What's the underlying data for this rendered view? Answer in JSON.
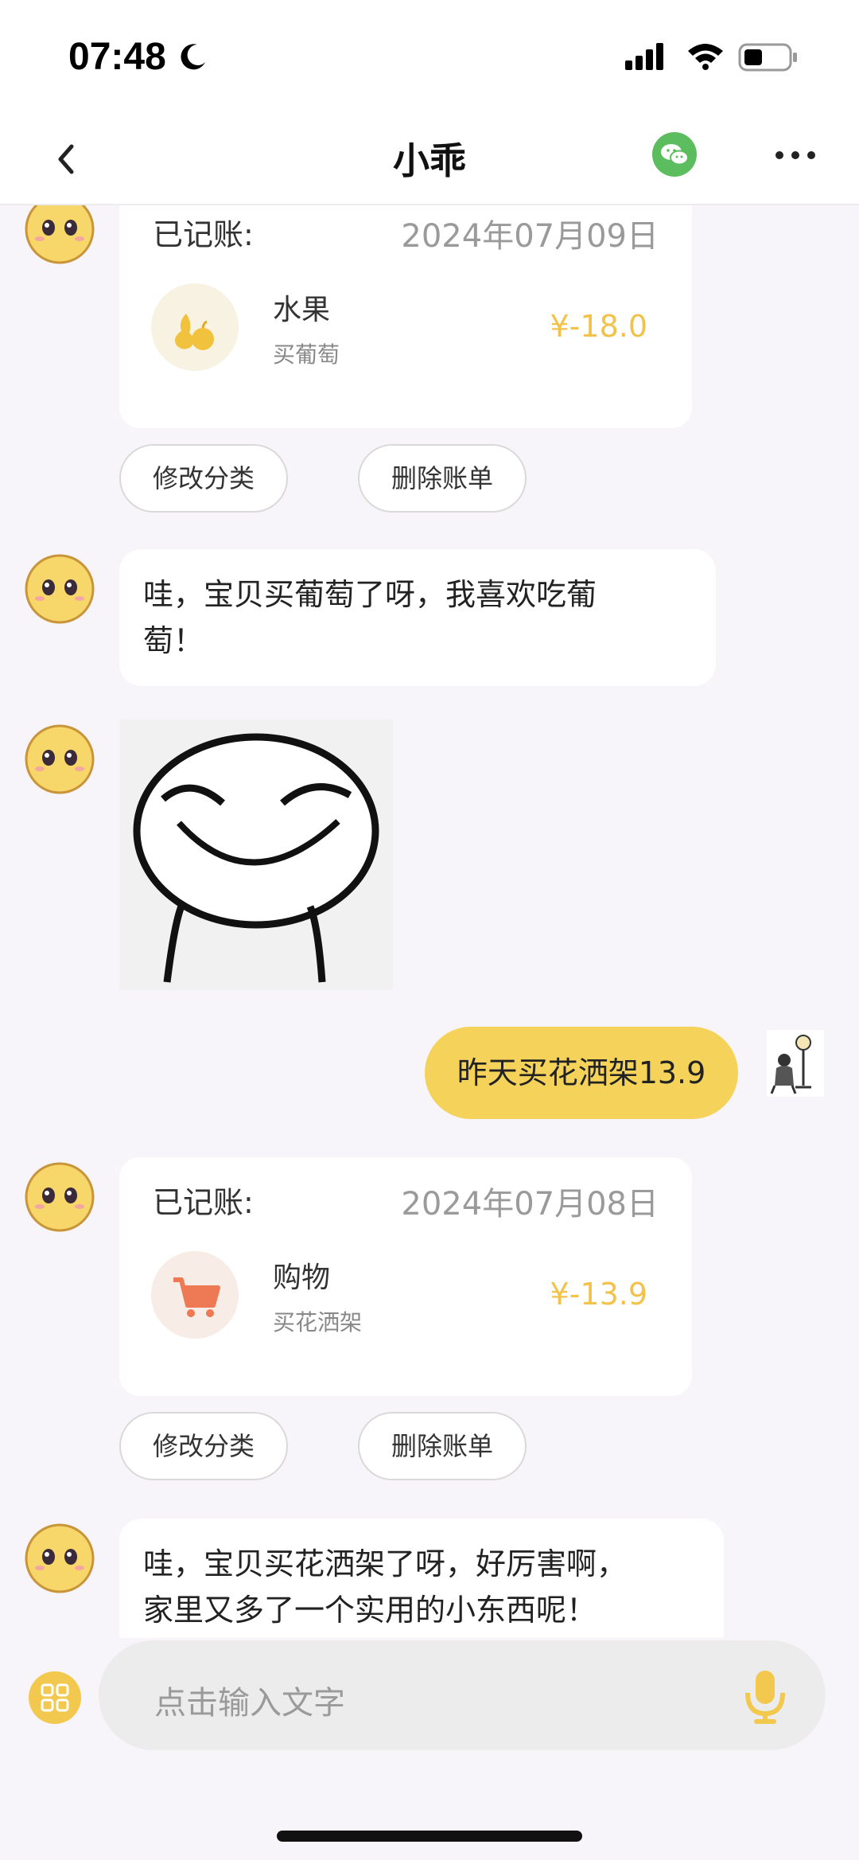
{
  "status_bar": {
    "time": "07:48"
  },
  "nav": {
    "title": "小乖"
  },
  "records": [
    {
      "label": "已记账:",
      "date": "2024年07月09日",
      "category": "水果",
      "note": "买葡萄",
      "amount": "¥-18.0",
      "actions": [
        "修改分类",
        "删除账单"
      ]
    },
    {
      "label": "已记账:",
      "date": "2024年07月08日",
      "category": "购物",
      "note": "买花洒架",
      "amount": "¥-13.9",
      "actions": [
        "修改分类",
        "删除账单"
      ]
    }
  ],
  "messages": {
    "reply1_line1": "哇，宝贝买葡萄了呀，我喜欢吃葡",
    "reply1_line2": "萄！",
    "user_msg": "昨天买花洒架13.9",
    "reply2_line1": "哇，宝贝买花洒架了呀，好厉害啊，",
    "reply2_line2": "家里又多了一个实用的小东西呢！"
  },
  "input": {
    "placeholder": "点击输入文字"
  },
  "colors": {
    "accent": "#f5d35b",
    "amount": "#f2c24a",
    "wechat": "#5cbd5e"
  }
}
